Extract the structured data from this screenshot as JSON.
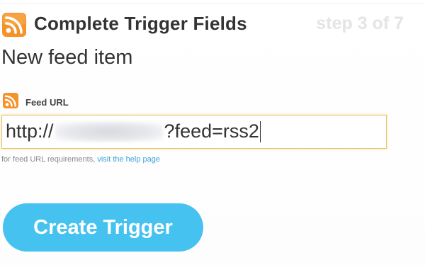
{
  "header": {
    "title": "Complete Trigger Fields",
    "step": "step 3 of 7",
    "icon": "rss-feed-icon"
  },
  "subtitle": "New feed item",
  "field": {
    "label": "Feed URL",
    "icon": "rss-feed-icon",
    "value_prefix": "http://",
    "value_suffix": "?feed=rss2"
  },
  "help": {
    "text": "for feed URL requirements,",
    "link": "visit the help page"
  },
  "action": {
    "create_label": "Create Trigger"
  },
  "colors": {
    "accent": "#45c2f0",
    "rss_orange": "#f5932b",
    "link": "#3ba3d8",
    "input_border": "#e8c56a"
  }
}
